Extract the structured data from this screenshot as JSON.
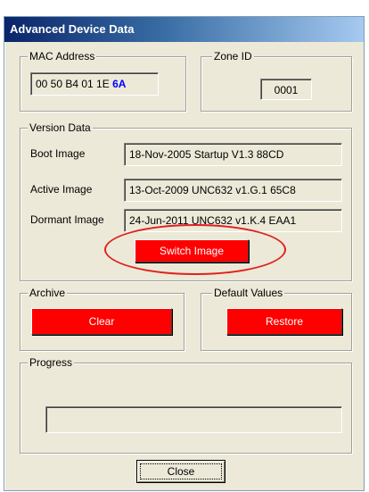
{
  "window": {
    "title": "Advanced Device Data"
  },
  "mac": {
    "label": "MAC Address",
    "prefix": "00 50 B4 01 1E ",
    "suffix": "6A"
  },
  "zone": {
    "label": "Zone ID",
    "value": "0001"
  },
  "version": {
    "label": "Version Data",
    "rows": [
      {
        "label": "Boot Image",
        "value": "18-Nov-2005 Startup V1.3  88CD"
      },
      {
        "label": "Active Image",
        "value": "13-Oct-2009 UNC632 v1.G.1  65C8"
      },
      {
        "label": "Dormant Image",
        "value": "24-Jun-2011 UNC632 v1.K.4  EAA1"
      }
    ],
    "switch_label": "Switch Image"
  },
  "archive": {
    "label": "Archive",
    "button": "Clear"
  },
  "defaults": {
    "label": "Default Values",
    "button": "Restore"
  },
  "progress": {
    "label": "Progress",
    "value": 0
  },
  "close_label": "Close",
  "colors": {
    "accent_red": "#ff0000",
    "annotation_red": "#e02020",
    "highlight_blue": "#0000ff"
  }
}
